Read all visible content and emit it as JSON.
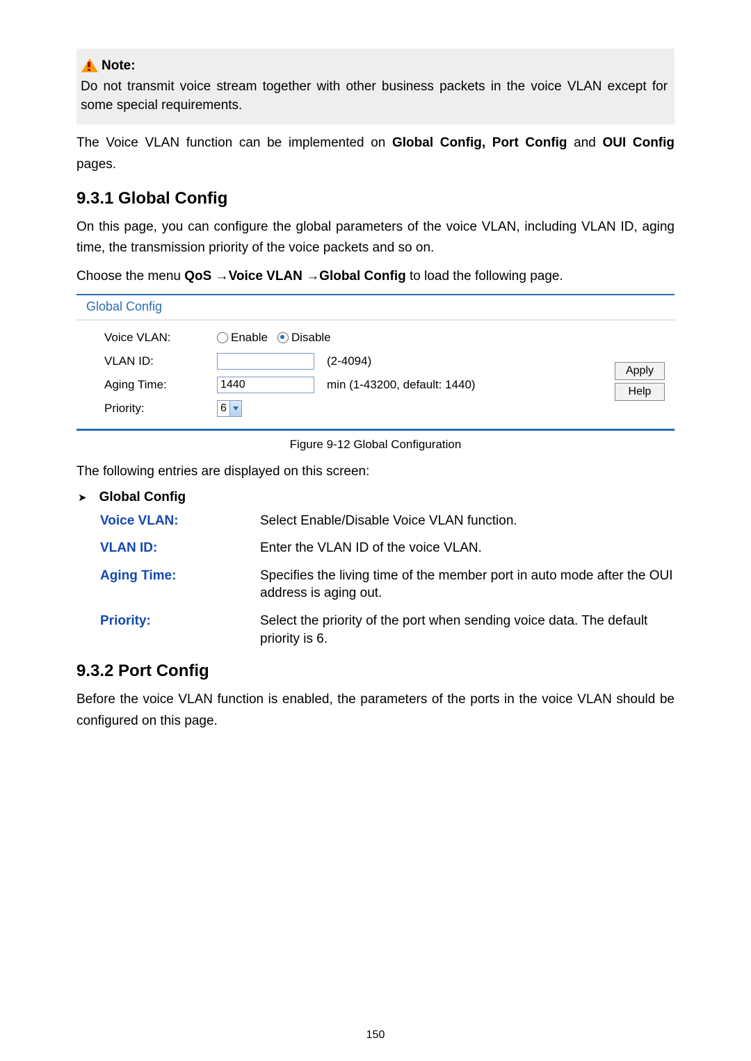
{
  "note": {
    "label": "Note:",
    "text": "Do not transmit voice stream together with other business packets in the voice VLAN except for some special requirements."
  },
  "intro_pre": "The Voice VLAN function can be implemented on ",
  "intro_bold": "Global Config, Port Config",
  "intro_mid": " and ",
  "intro_bold2": "OUI Config",
  "intro_post": " pages.",
  "section1": {
    "heading": "9.3.1 Global Config",
    "p1": "On this page, you can configure the global parameters of the voice VLAN, including VLAN ID, aging time, the transmission priority of the voice packets and so on.",
    "nav_pre": "Choose the menu ",
    "nav_bold": "QoS →Voice VLAN →Global Config",
    "nav_post": " to load the following page."
  },
  "figure": {
    "panel_title": "Global Config",
    "rows": {
      "voice_vlan_label": "Voice VLAN:",
      "enable": "Enable",
      "disable": "Disable",
      "vlan_id_label": "VLAN ID:",
      "vlan_id_value": "",
      "vlan_id_hint": "(2-4094)",
      "aging_label": "Aging Time:",
      "aging_value": "1440",
      "aging_hint": "min (1-43200, default: 1440)",
      "priority_label": "Priority:",
      "priority_value": "6"
    },
    "apply": "Apply",
    "help": "Help",
    "caption": "Figure 9-12 Global Configuration"
  },
  "entries_intro": "The following entries are displayed on this screen:",
  "entries_heading": "Global Config",
  "defs": [
    {
      "term": "Voice VLAN:",
      "desc": "Select Enable/Disable Voice VLAN function."
    },
    {
      "term": "VLAN ID:",
      "desc": "Enter the VLAN ID of the voice VLAN."
    },
    {
      "term": "Aging Time:",
      "desc": "Specifies the living time of the member port in auto mode after the OUI address is aging out."
    },
    {
      "term": "Priority:",
      "desc": "Select the priority of the port when sending voice data. The default priority is 6."
    }
  ],
  "section2": {
    "heading": "9.3.2 Port Config",
    "p1": "Before the voice VLAN function is enabled, the parameters of the ports in the voice VLAN should be configured on this page."
  },
  "chart_data": {
    "type": "table",
    "title": "Global Config form",
    "rows": [
      {
        "field": "Voice VLAN",
        "value": "Disable",
        "options": [
          "Enable",
          "Disable"
        ]
      },
      {
        "field": "VLAN ID",
        "value": "",
        "range": "2-4094"
      },
      {
        "field": "Aging Time",
        "value": 1440,
        "unit": "min",
        "range": "1-43200",
        "default": 1440
      },
      {
        "field": "Priority",
        "value": 6
      }
    ]
  },
  "page_number": "150"
}
